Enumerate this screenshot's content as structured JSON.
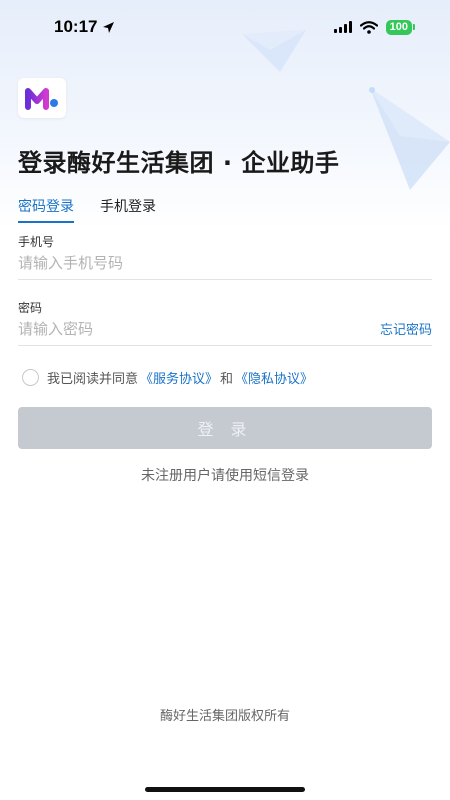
{
  "status": {
    "time": "10:17",
    "battery": "100"
  },
  "brand": {
    "title": "登录酶好生活集团 · 企业助手",
    "logo_icon": "brand-logo-m"
  },
  "tabs": [
    {
      "label": "密码登录",
      "active": true
    },
    {
      "label": "手机登录",
      "active": false
    }
  ],
  "form": {
    "phone_label": "手机号",
    "phone_placeholder": "请输入手机号码",
    "phone_value": "",
    "password_label": "密码",
    "password_placeholder": "请输入密码",
    "password_value": "",
    "forgot_label": "忘记密码"
  },
  "agreement": {
    "prefix": "我已阅读并同意",
    "service_link": "《服务协议》",
    "conjunction": "和",
    "privacy_link": "《隐私协议》",
    "checked": false
  },
  "login_button": "登 录",
  "sms_hint": "未注册用户请使用短信登录",
  "footer": {
    "copyright": "酶好生活集团版权所有"
  },
  "colors": {
    "accent": "#1a73c9",
    "button_disabled": "#c5c9d0",
    "battery": "#34c759"
  }
}
